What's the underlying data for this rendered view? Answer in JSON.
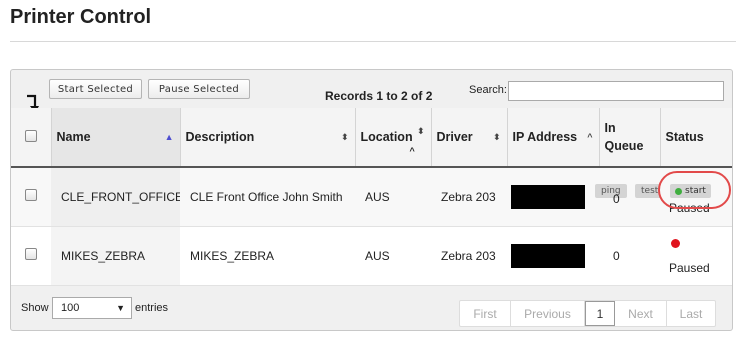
{
  "page": {
    "title": "Printer Control"
  },
  "toolbar": {
    "start_selected": "Start Selected",
    "pause_selected": "Pause Selected",
    "records_info": "Records 1 to 2 of 2",
    "search_label": "Search:",
    "search_value": ""
  },
  "table": {
    "headers": {
      "name": "Name",
      "description": "Description",
      "location": "Location",
      "driver": "Driver",
      "ip_address": "IP Address",
      "in_queue_1": "In",
      "in_queue_2": "Queue",
      "status": "Status"
    },
    "rows": [
      {
        "name": "CLE_FRONT_OFFICE",
        "description": "CLE Front Office John Smith",
        "location": "AUS",
        "driver": "Zebra 203",
        "in_queue": "0",
        "ping_label": "ping",
        "test_label": "test",
        "start_label": "start",
        "status": "Paused"
      },
      {
        "name": "MIKES_ZEBRA",
        "description": "MIKES_ZEBRA",
        "location": "AUS",
        "driver": "Zebra 203",
        "in_queue": "0",
        "status": "Paused"
      }
    ]
  },
  "footer": {
    "show_label": "Show",
    "page_size": "100",
    "entries_label": "entries",
    "pager": {
      "first": "First",
      "previous": "Previous",
      "current": "1",
      "next": "Next",
      "last": "Last"
    }
  },
  "colors": {
    "status_paused_dot": "#e0141e",
    "start_dot": "#3fae3f",
    "highlight": "#e24a4a"
  }
}
